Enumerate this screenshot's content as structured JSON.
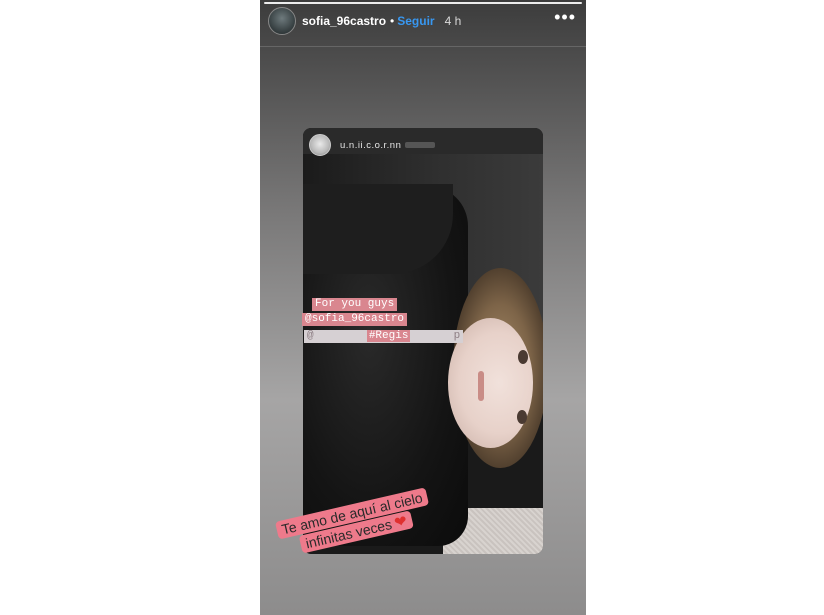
{
  "header": {
    "username": "sofia_96castro",
    "separator": "•",
    "follow_label": "Seguir",
    "time_ago": "4 h",
    "more_icon": "•••"
  },
  "shared_post": {
    "username": "u.n.ii.c.o.r.nn"
  },
  "stickers": {
    "line1": "For you guys",
    "line2": "@sofia_96castro",
    "line3_prefix": "@",
    "line3_tag": "#Regis",
    "line3_suffix": "p"
  },
  "caption": {
    "line1": "Te amo de aquí al cielo",
    "line2": "infinitas veces",
    "heart": "❤"
  },
  "colors": {
    "follow": "#3897f0",
    "sticker_bg": "#d9868f",
    "caption_bg": "#ee7a8b",
    "heart": "#e0302f"
  }
}
